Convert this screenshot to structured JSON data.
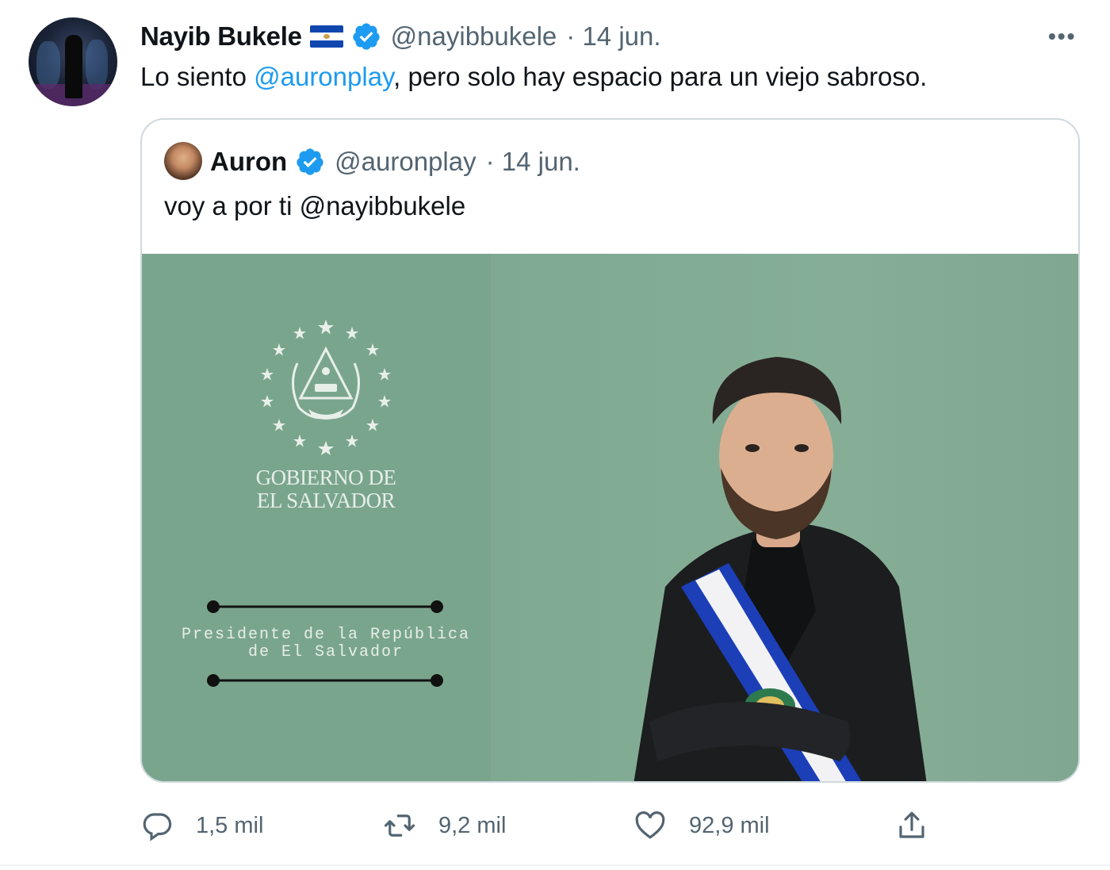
{
  "tweet": {
    "author_name": "Nayib Bukele",
    "flag": "el-salvador-flag",
    "handle": "@nayibbukele",
    "date": "· 14 jun.",
    "more": "•••",
    "text_before": "Lo siento ",
    "mention": "@auronplay",
    "text_after": ", pero solo hay espacio para un viejo sabroso."
  },
  "quote": {
    "author_name": "Auron",
    "handle": "@auronplay",
    "date": "· 14 jun.",
    "text": "voy a por ti @nayibbukele",
    "media": {
      "gov_line1": "GOBIERNO DE",
      "gov_line2": "EL SALVADOR",
      "pres_line1": "Presidente de la República",
      "pres_line2": "de El Salvador"
    }
  },
  "actions": {
    "reply_count": "1,5 mil",
    "retweet_count": "9,2 mil",
    "like_count": "92,9 mil"
  },
  "colors": {
    "accent": "#1d9bf0",
    "muted": "#536471",
    "border": "#cfd9de",
    "media_bg": "#7ea890"
  }
}
